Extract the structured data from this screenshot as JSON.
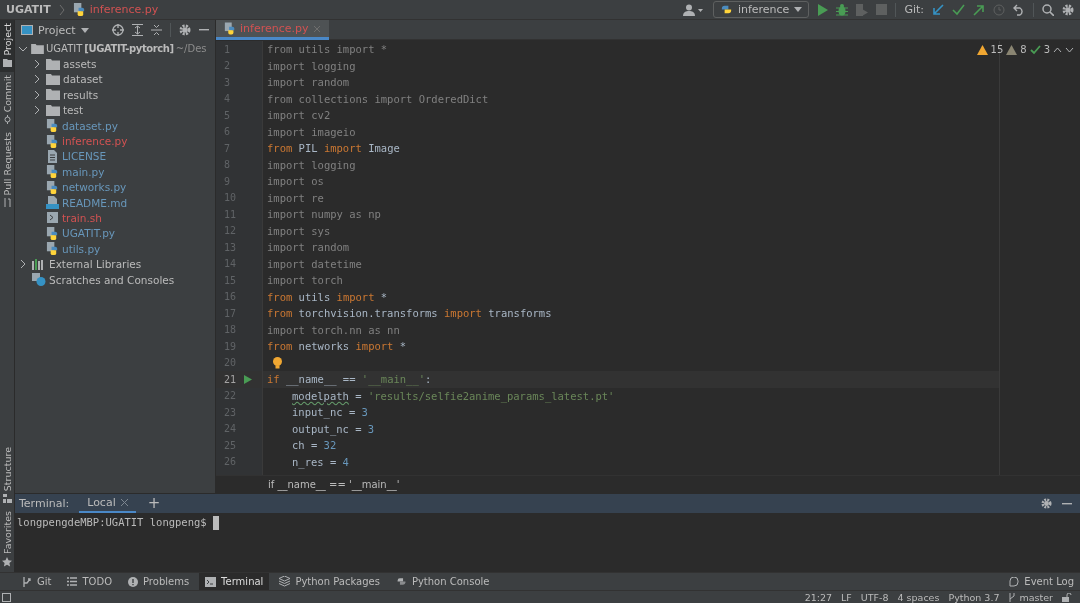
{
  "breadcrumb": {
    "project": "UGATIT",
    "file": "inference.py"
  },
  "toolbar": {
    "run_config": "inference",
    "git_label": "Git:"
  },
  "side_stripe": {
    "top": [
      {
        "label": "Project",
        "selected": true,
        "kind": "folder"
      },
      {
        "label": "Commit",
        "selected": false,
        "kind": "commit"
      },
      {
        "label": "Pull Requests",
        "selected": false,
        "kind": "pr"
      }
    ],
    "bottom": [
      {
        "label": "Structure",
        "selected": false,
        "kind": "structure"
      },
      {
        "label": "Favorites",
        "selected": false,
        "kind": "star"
      }
    ]
  },
  "project_panel": {
    "title": "Project",
    "root": {
      "name": "UGATIT",
      "module": "[UGATIT-pytorch]",
      "path": "~/Des",
      "expanded": true,
      "children": [
        {
          "name": "assets",
          "kind": "folder",
          "color": "#bbbbbb",
          "expanded": false
        },
        {
          "name": "dataset",
          "kind": "folder",
          "color": "#bbbbbb",
          "expanded": false
        },
        {
          "name": "results",
          "kind": "folder",
          "color": "#bbbbbb",
          "expanded": false
        },
        {
          "name": "test",
          "kind": "folder",
          "color": "#bbbbbb",
          "expanded": false
        },
        {
          "name": "dataset.py",
          "kind": "py",
          "color": "#6897bb"
        },
        {
          "name": "inference.py",
          "kind": "py",
          "color": "#d25252"
        },
        {
          "name": "LICENSE",
          "kind": "text",
          "color": "#6897bb"
        },
        {
          "name": "main.py",
          "kind": "py",
          "color": "#6897bb"
        },
        {
          "name": "networks.py",
          "kind": "py",
          "color": "#6897bb"
        },
        {
          "name": "README.md",
          "kind": "md",
          "color": "#6897bb"
        },
        {
          "name": "train.sh",
          "kind": "sh",
          "color": "#d25252"
        },
        {
          "name": "UGATIT.py",
          "kind": "py",
          "color": "#6897bb"
        },
        {
          "name": "utils.py",
          "kind": "py",
          "color": "#6897bb"
        }
      ]
    },
    "extra": [
      {
        "name": "External Libraries",
        "kind": "lib",
        "expanded": false
      },
      {
        "name": "Scratches and Consoles",
        "kind": "scratch"
      }
    ]
  },
  "editor": {
    "tabs": [
      {
        "label": "inference.py",
        "selected": true
      }
    ],
    "inspections": {
      "warnings": "15",
      "weak_warnings": "8",
      "typos": "3"
    },
    "lines": [
      {
        "n": "1",
        "current": false,
        "tokens": [
          {
            "t": "from utils import *",
            "kind": "gray"
          }
        ]
      },
      {
        "n": "2",
        "current": false,
        "tokens": [
          {
            "t": "import logging",
            "kind": "gray"
          }
        ]
      },
      {
        "n": "3",
        "current": false,
        "tokens": [
          {
            "t": "import random",
            "kind": "gray"
          }
        ]
      },
      {
        "n": "4",
        "current": false,
        "tokens": [
          {
            "t": "from collections import OrderedDict",
            "kind": "gray"
          }
        ]
      },
      {
        "n": "5",
        "current": false,
        "tokens": [
          {
            "t": "import cv2",
            "kind": "gray"
          }
        ]
      },
      {
        "n": "6",
        "current": false,
        "tokens": [
          {
            "t": "import imageio",
            "kind": "gray"
          }
        ]
      },
      {
        "n": "7",
        "current": false,
        "tokens": [
          {
            "t": "from",
            "kind": "kw"
          },
          {
            "t": " PIL ",
            "kind": "id"
          },
          {
            "t": "import",
            "kind": "kw"
          },
          {
            "t": " Image",
            "kind": "id"
          }
        ]
      },
      {
        "n": "8",
        "current": false,
        "tokens": [
          {
            "t": "import logging",
            "kind": "gray"
          }
        ]
      },
      {
        "n": "9",
        "current": false,
        "tokens": [
          {
            "t": "import os",
            "kind": "gray"
          }
        ]
      },
      {
        "n": "10",
        "current": false,
        "tokens": [
          {
            "t": "import re",
            "kind": "gray"
          }
        ]
      },
      {
        "n": "11",
        "current": false,
        "tokens": [
          {
            "t": "import numpy as np",
            "kind": "gray"
          }
        ]
      },
      {
        "n": "12",
        "current": false,
        "tokens": [
          {
            "t": "import sys",
            "kind": "gray"
          }
        ]
      },
      {
        "n": "13",
        "current": false,
        "tokens": [
          {
            "t": "import random",
            "kind": "gray"
          }
        ]
      },
      {
        "n": "14",
        "current": false,
        "tokens": [
          {
            "t": "import datetime",
            "kind": "gray"
          }
        ]
      },
      {
        "n": "15",
        "current": false,
        "tokens": [
          {
            "t": "import torch",
            "kind": "gray"
          }
        ]
      },
      {
        "n": "16",
        "current": false,
        "tokens": [
          {
            "t": "from",
            "kind": "kw"
          },
          {
            "t": " utils ",
            "kind": "id"
          },
          {
            "t": "import",
            "kind": "kw"
          },
          {
            "t": " *",
            "kind": "id"
          }
        ]
      },
      {
        "n": "17",
        "current": false,
        "tokens": [
          {
            "t": "from",
            "kind": "kw"
          },
          {
            "t": " torchvision.transforms ",
            "kind": "id"
          },
          {
            "t": "import",
            "kind": "kw"
          },
          {
            "t": " transforms",
            "kind": "id"
          }
        ]
      },
      {
        "n": "18",
        "current": false,
        "tokens": [
          {
            "t": "import torch.nn as nn",
            "kind": "gray"
          }
        ]
      },
      {
        "n": "19",
        "current": false,
        "tokens": [
          {
            "t": "from",
            "kind": "kw"
          },
          {
            "t": " networks ",
            "kind": "id"
          },
          {
            "t": "import",
            "kind": "kw"
          },
          {
            "t": " *",
            "kind": "id"
          }
        ]
      },
      {
        "n": "20",
        "current": false,
        "kind": "bulb"
      },
      {
        "n": "21",
        "current": true,
        "kind": "run",
        "tokens": [
          {
            "t": "if",
            "kind": "kw"
          },
          {
            "t": " __name__ == ",
            "kind": "id"
          },
          {
            "t": "'__main__'",
            "kind": "str"
          },
          {
            "t": ":",
            "kind": "id"
          }
        ],
        "children": [
          {
            "n": "22",
            "current": false,
            "tokens": [
              {
                "t": "modelpath",
                "kind": "typo"
              },
              {
                "t": " = ",
                "kind": "id"
              },
              {
                "t": "'results/selfie2anime_params_latest.pt'",
                "kind": "str"
              }
            ]
          },
          {
            "n": "23",
            "current": false,
            "tokens": [
              {
                "t": "input_nc = ",
                "kind": "id"
              },
              {
                "t": "3",
                "kind": "num"
              }
            ]
          },
          {
            "n": "24",
            "current": false,
            "tokens": [
              {
                "t": "output_nc = ",
                "kind": "id"
              },
              {
                "t": "3",
                "kind": "num"
              }
            ]
          },
          {
            "n": "25",
            "current": false,
            "tokens": [
              {
                "t": "ch = ",
                "kind": "id"
              },
              {
                "t": "32",
                "kind": "num"
              }
            ]
          },
          {
            "n": "26",
            "current": false,
            "tokens": [
              {
                "t": "n_res = ",
                "kind": "id"
              },
              {
                "t": "4",
                "kind": "num"
              }
            ]
          }
        ]
      }
    ],
    "code_breadcrumb": "if __name__ == '__main__'"
  },
  "terminal": {
    "title": "Terminal:",
    "tabs": [
      {
        "label": "Local",
        "selected": true
      }
    ],
    "add": "+",
    "prompt": "longpengdeMBP:UGATIT longpeng$"
  },
  "tool_tabs": [
    {
      "label": "Git",
      "kind": "git",
      "selected": false
    },
    {
      "label": "TODO",
      "kind": "todo",
      "selected": false
    },
    {
      "label": "Problems",
      "kind": "problems",
      "selected": false
    },
    {
      "label": "Terminal",
      "kind": "terminal",
      "selected": true
    },
    {
      "label": "Python Packages",
      "kind": "packages",
      "selected": false
    },
    {
      "label": "Python Console",
      "kind": "console",
      "selected": false
    }
  ],
  "event_log": "Event Log",
  "status_bar": {
    "position": "21:27",
    "line_sep": "LF",
    "encoding": "UTF-8",
    "indent": "4 spaces",
    "interpreter": "Python 3.7",
    "branch": "master"
  }
}
